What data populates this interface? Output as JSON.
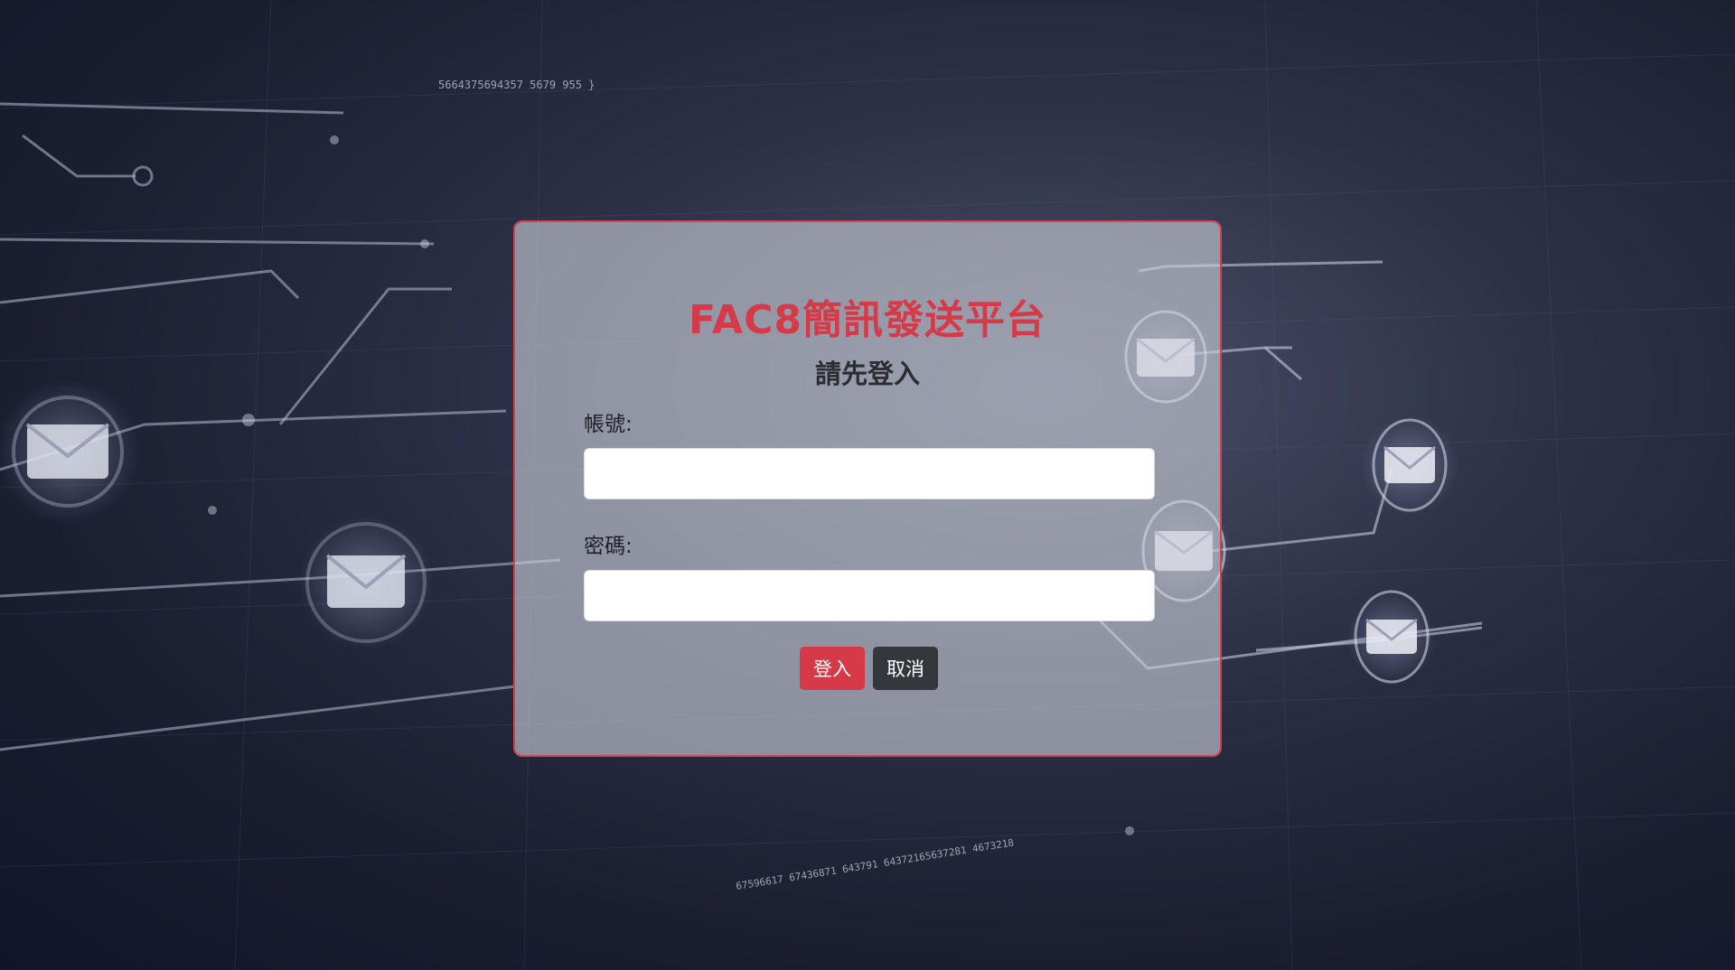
{
  "login": {
    "title": "FAC8簡訊發送平台",
    "subtitle": "請先登入",
    "username_label": "帳號:",
    "username_value": "",
    "password_label": "密碼:",
    "password_value": "",
    "login_button": "登入",
    "cancel_button": "取消"
  },
  "background": {
    "code_text_1": "5664375694357  5679  955 }",
    "code_text_2": "67596617  67436871 643791  64372165637281  4673218"
  },
  "colors": {
    "accent": "#d63a48",
    "dark_button": "#34373c",
    "background": "#1a1e30"
  },
  "icons": [
    "envelope-icon"
  ]
}
